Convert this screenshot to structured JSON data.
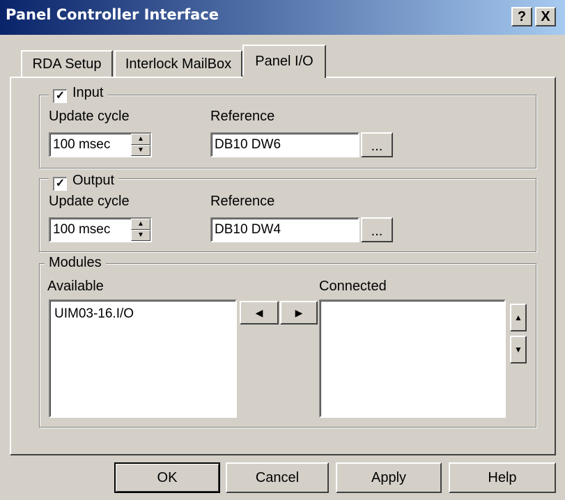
{
  "window": {
    "title": "Panel Controller Interface",
    "help_button": "?",
    "close_button": "X"
  },
  "tabs": [
    {
      "label": "RDA Setup"
    },
    {
      "label": "Interlock MailBox"
    },
    {
      "label": "Panel I/O",
      "active": true
    }
  ],
  "input": {
    "legend": "Input",
    "checked": true,
    "check_mark": "✓",
    "update_cycle_label": "Update cycle",
    "update_cycle_value": "100 msec",
    "reference_label": "Reference",
    "reference_value": "DB10 DW6",
    "browse_label": "..."
  },
  "output": {
    "legend": "Output",
    "checked": true,
    "check_mark": "✓",
    "update_cycle_label": "Update cycle",
    "update_cycle_value": "100 msec",
    "reference_label": "Reference",
    "reference_value": "DB10 DW4",
    "browse_label": "..."
  },
  "modules": {
    "legend": "Modules",
    "available_label": "Available",
    "available_items": [
      "UIM03-16.I/O"
    ],
    "connected_label": "Connected",
    "connected_items": []
  },
  "buttons": {
    "ok": "OK",
    "cancel": "Cancel",
    "apply": "Apply",
    "help": "Help"
  },
  "icons": {
    "spin_up": "▲",
    "spin_down": "▼",
    "arrow_left": "◀",
    "arrow_right": "▶",
    "move_up": "▲",
    "move_down": "▼"
  }
}
